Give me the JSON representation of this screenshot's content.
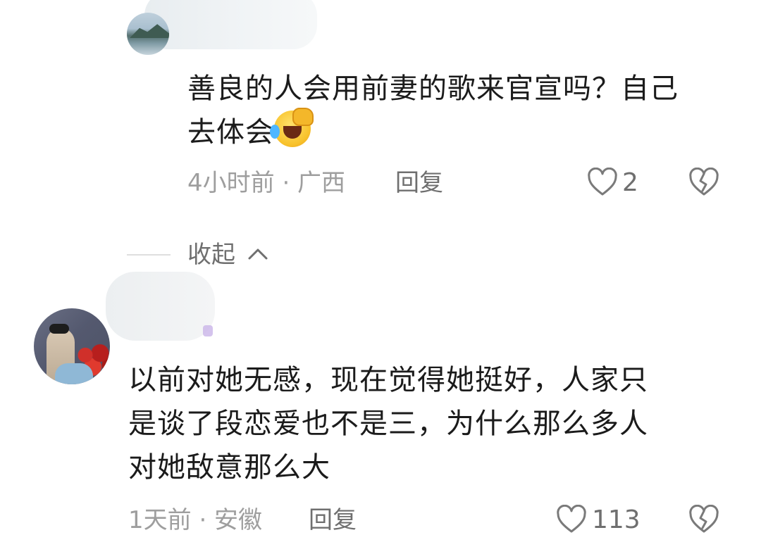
{
  "reply": {
    "text_line1": "善良的人会用前妻的歌来官宣吗？自己",
    "text_line2": "去体会",
    "meta": "4小时前 · 广西",
    "reply_label": "回复",
    "like_count": "2"
  },
  "collapse": {
    "label": "收起"
  },
  "comment": {
    "text_line1": "以前对她无感，现在觉得她挺好，人家只",
    "text_line2": "是谈了段恋爱也不是三，为什么那么多人",
    "text_line3": "对她敌意那么大",
    "meta": "1天前 · 安徽",
    "reply_label": "回复",
    "like_count": "113"
  },
  "icons": {
    "like": "heart-outline-icon",
    "dislike": "broken-heart-icon",
    "expand": "chevron-up-icon",
    "emoji": "laughing-crying-emoji-icon"
  },
  "colors": {
    "text": "#1b1b1b",
    "meta": "#9e9e9e",
    "action": "#6f6f6f"
  }
}
